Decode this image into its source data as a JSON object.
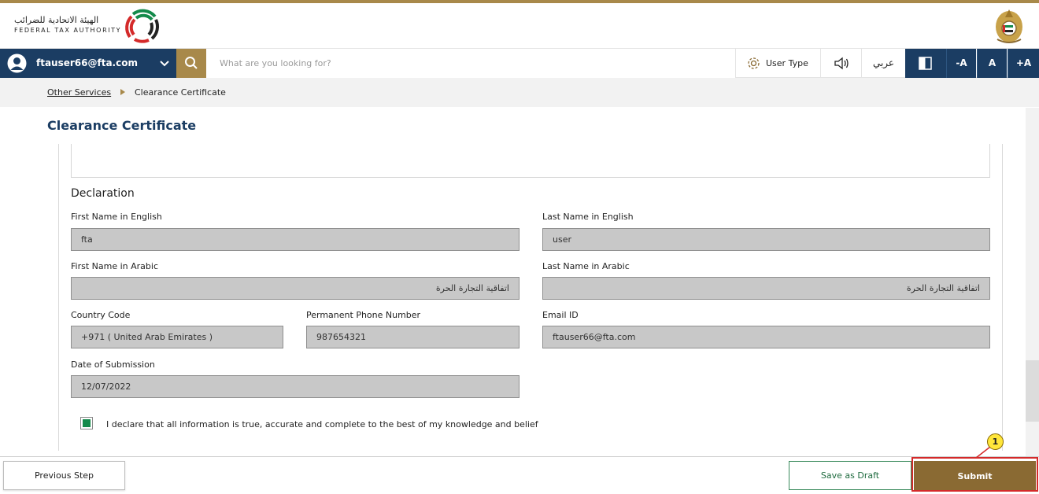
{
  "header": {
    "logo_arabic": "الهيئة الاتحادية للضرائب",
    "logo_english": "FEDERAL TAX AUTHORITY",
    "logo_icon": "fta-logo-icon",
    "emblem_icon": "uae-emblem-icon"
  },
  "navbar": {
    "user_email": "ftauser66@fta.com",
    "search_placeholder": "What are you looking for?",
    "user_type_label": "User Type",
    "arabic_label": "عربي",
    "font_decrease": "-A",
    "font_reset": "A",
    "font_increase": "+A"
  },
  "breadcrumb": {
    "parent": "Other Services",
    "current": "Clearance Certificate"
  },
  "page": {
    "title": "Clearance Certificate"
  },
  "declaration": {
    "section_title": "Declaration",
    "first_name_en_label": "First Name in English",
    "first_name_en_value": "fta",
    "last_name_en_label": "Last Name in English",
    "last_name_en_value": "user",
    "first_name_ar_label": "First Name in Arabic",
    "first_name_ar_value": "اتفاقية التجارة الحرة",
    "last_name_ar_label": "Last Name in Arabic",
    "last_name_ar_value": "اتفاقية التجارة الحرة",
    "country_code_label": "Country Code",
    "country_code_value": "+971 ( United Arab Emirates )",
    "phone_label": "Permanent Phone Number",
    "phone_value": "987654321",
    "email_label": "Email ID",
    "email_value": "ftauser66@fta.com",
    "date_label": "Date of Submission",
    "date_value": "12/07/2022",
    "declare_checked": true,
    "declare_text": "I declare that all information is true, accurate and complete to the best of my knowledge and belief"
  },
  "footer": {
    "previous_label": "Previous Step",
    "draft_label": "Save as Draft",
    "submit_label": "Submit"
  },
  "annotation": {
    "callout_number": "1"
  },
  "colors": {
    "brand_navy": "#1b3d63",
    "brand_gold": "#a8894a",
    "submit_brown": "#8a6a33",
    "draft_green": "#1f6b3f",
    "highlight_red": "#d42a2a"
  }
}
